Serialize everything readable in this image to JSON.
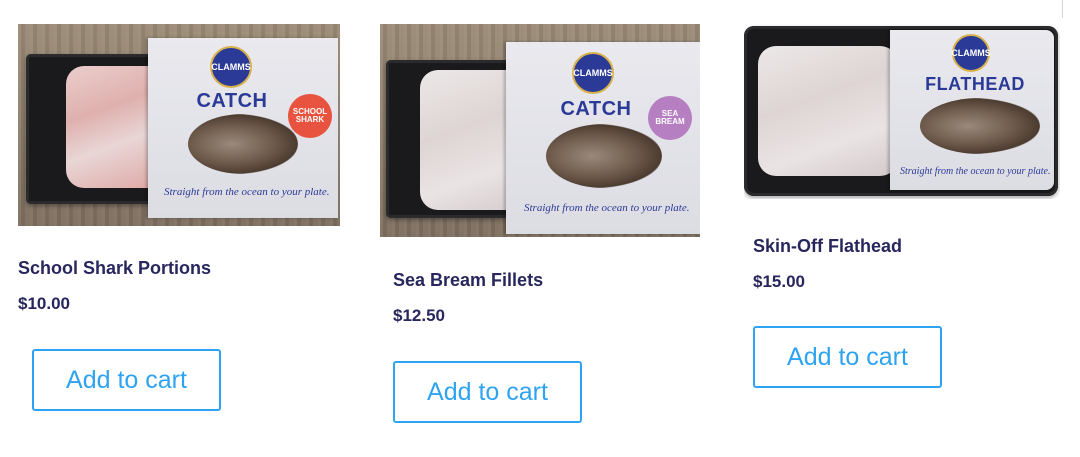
{
  "products": [
    {
      "title": "School Shark Portions",
      "price": "$10.00",
      "button_label": "Add to cart",
      "image": {
        "brand": "CLAMMS",
        "product_word": "CATCH",
        "sticker": "SCHOOL SHARK",
        "sticker_color": "#e8533f",
        "tagline": "Straight from the ocean to your plate."
      }
    },
    {
      "title": "Sea Bream Fillets",
      "price": "$12.50",
      "button_label": "Add to cart",
      "image": {
        "brand": "CLAMMS",
        "product_word": "CATCH",
        "sticker": "SEA BREAM",
        "sticker_color": "#b57fc2",
        "tagline": "Straight from the ocean to your plate."
      }
    },
    {
      "title": "Skin-Off Flathead",
      "price": "$15.00",
      "button_label": "Add to cart",
      "image": {
        "brand": "CLAMMS",
        "product_word": "FLATHEAD",
        "tagline": "Straight from the ocean to your plate."
      }
    }
  ],
  "colors": {
    "title": "#27265d",
    "button": "#2ea3f2",
    "brand_blue": "#2b3a97"
  }
}
